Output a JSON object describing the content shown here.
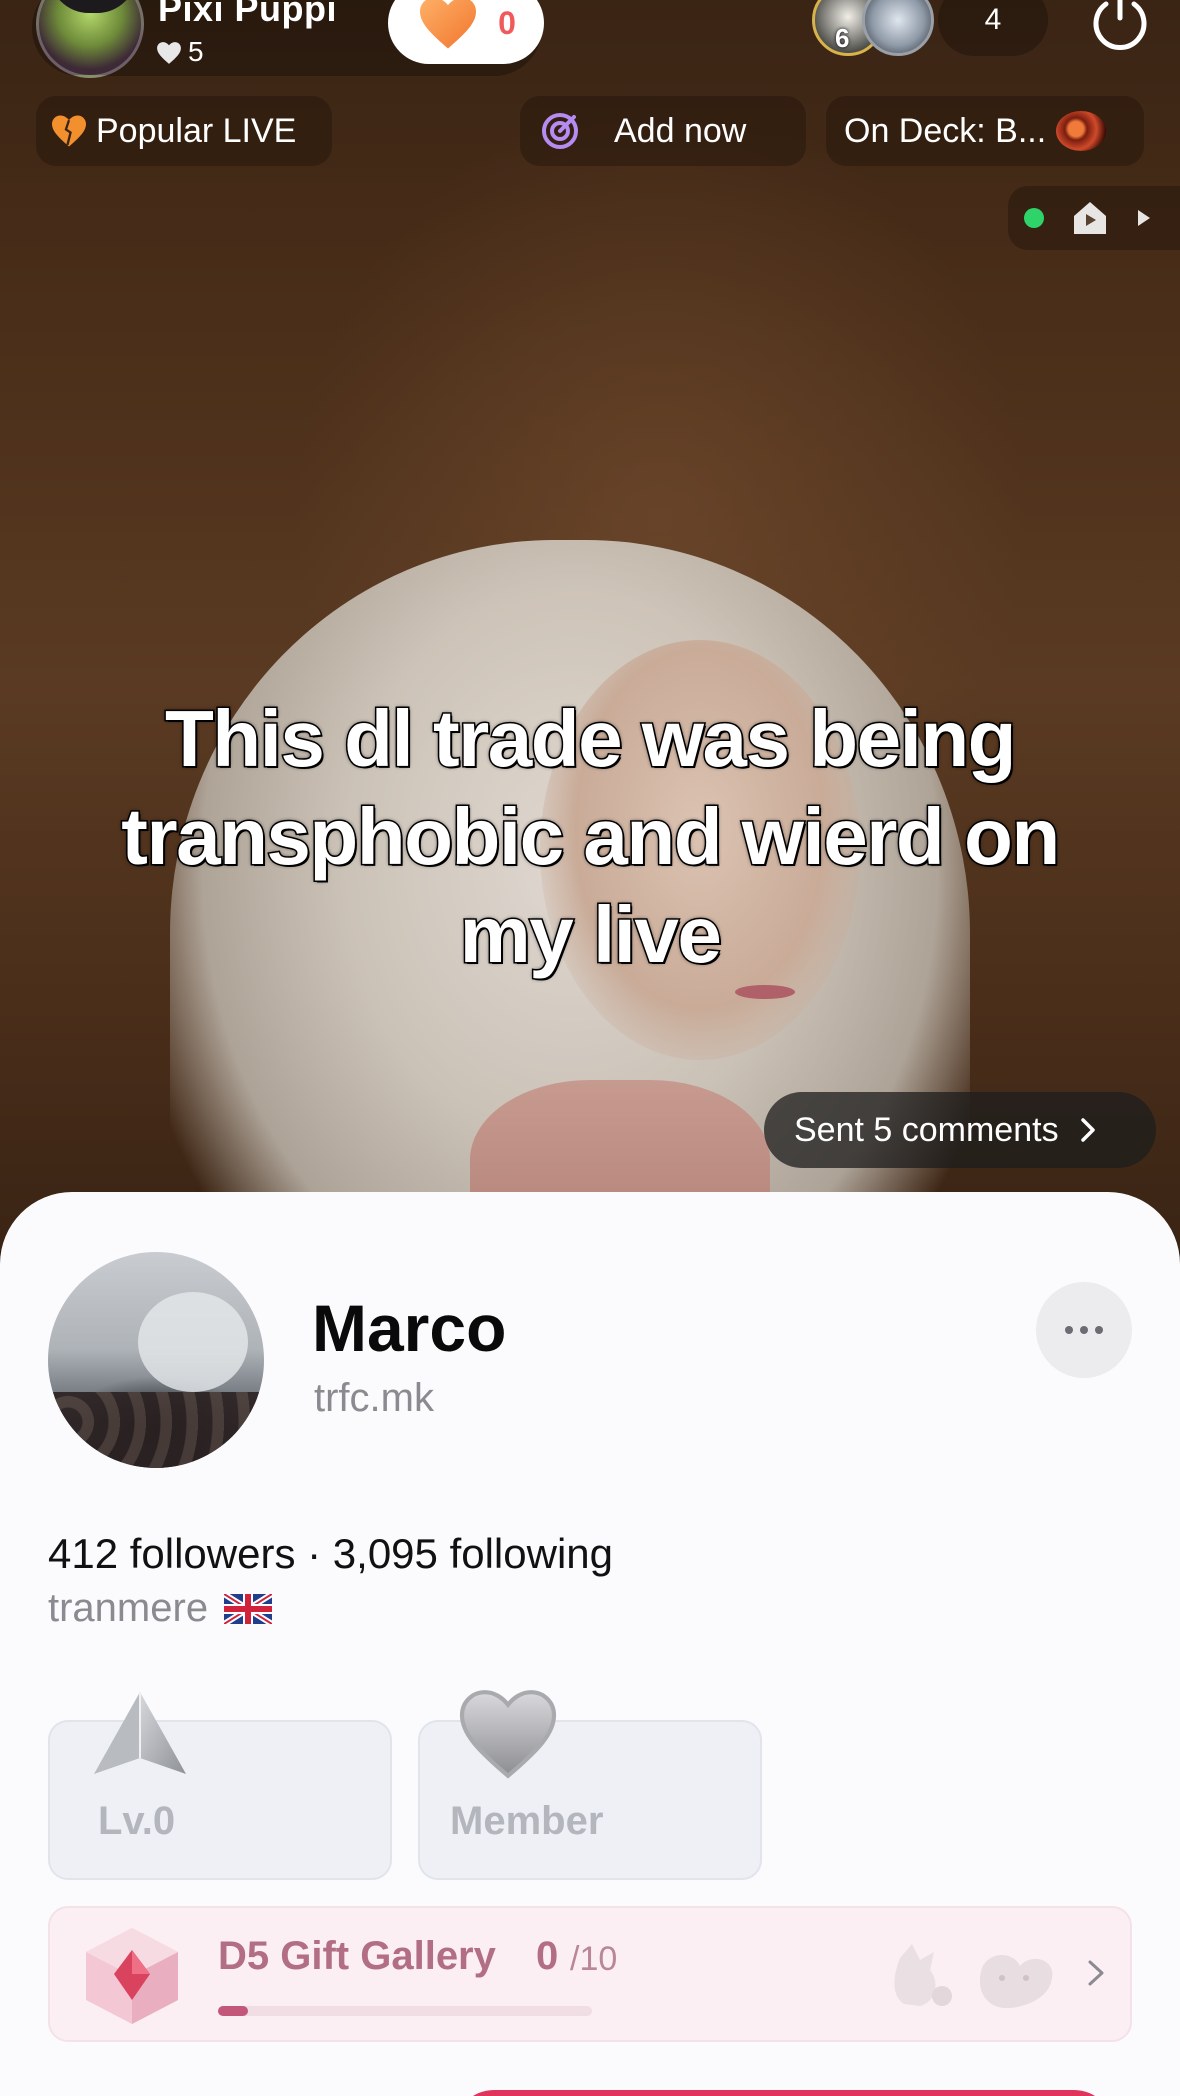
{
  "host": {
    "name": "Pixi Puppi",
    "likes": "5",
    "follow_heart_count": "0"
  },
  "top_viewers": {
    "first_rank": "6",
    "count": "4"
  },
  "chips": {
    "popular": "Popular LIVE",
    "add_now": "Add now",
    "on_deck": "On Deck: B..."
  },
  "caption": "This dl trade was being transphobic and wierd on my live",
  "sent_comments": "Sent 5 comments",
  "profile": {
    "name": "Marco",
    "handle": "trfc.mk",
    "stats": "412 followers · 3,095 following",
    "location": "tranmere"
  },
  "badges": {
    "level_label": "Lv.0",
    "member_label": "Member"
  },
  "gift_gallery": {
    "title": "D5 Gift Gallery",
    "count": "0",
    "total": "/10",
    "progress": 0.08
  },
  "colors": {
    "accent_red": "#e0345c",
    "live_dot": "#2ed46a",
    "gallery_text": "#b26e84"
  },
  "icons": [
    "heart-icon",
    "power-icon",
    "target-icon",
    "play-icon",
    "more-icon",
    "flag-uk-icon",
    "chevron-right-icon",
    "gem-icon"
  ]
}
